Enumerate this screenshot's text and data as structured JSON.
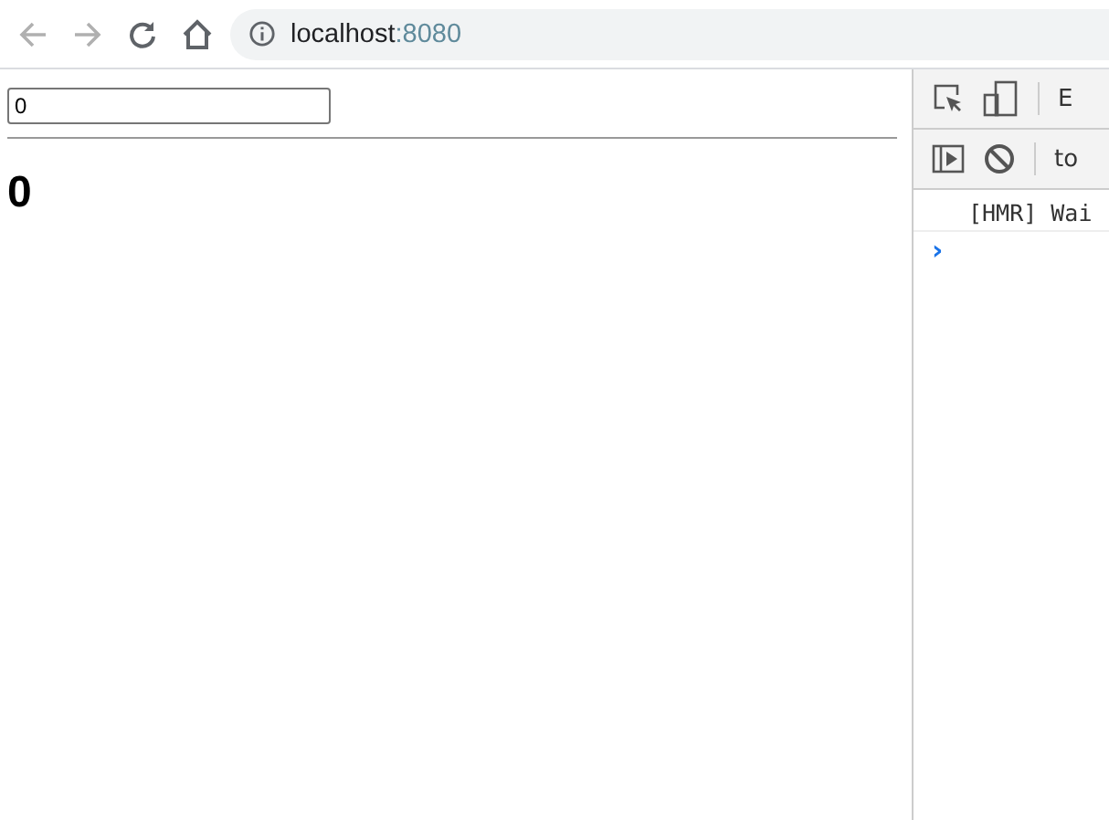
{
  "browser": {
    "url_host": "localhost",
    "url_port": ":8080",
    "back_disabled": true,
    "forward_disabled": true
  },
  "page": {
    "input_value": "0",
    "heading": "0"
  },
  "devtools": {
    "tab_partial": "E",
    "context": "to",
    "console_lines": [
      {
        "kind": "log",
        "text": "[HMR] Wai"
      },
      {
        "kind": "prompt",
        "text": "›"
      }
    ]
  }
}
